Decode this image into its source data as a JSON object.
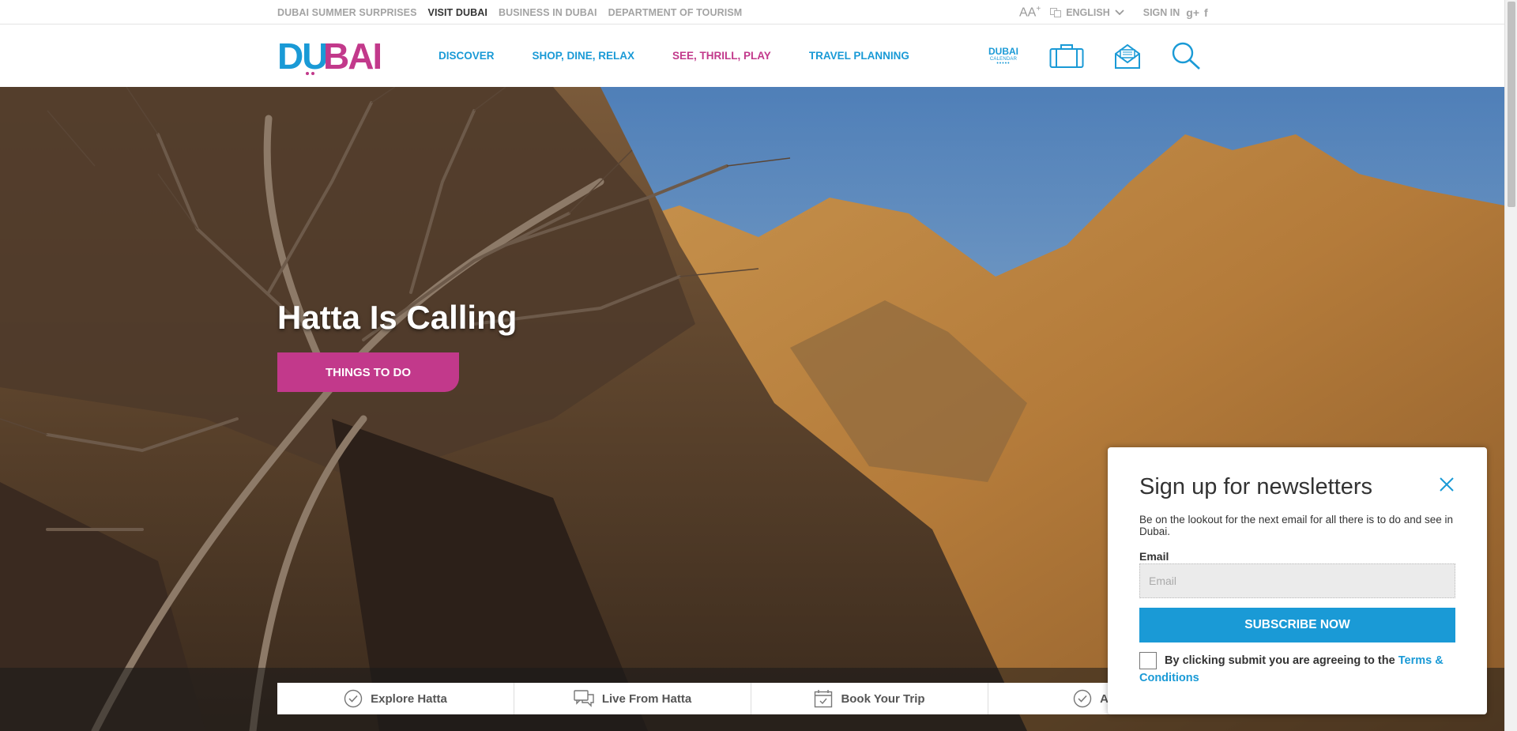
{
  "topbar": {
    "links": [
      "DUBAI SUMMER SURPRISES",
      "VISIT DUBAI",
      "BUSINESS IN DUBAI",
      "DEPARTMENT OF TOURISM"
    ],
    "active_link": "VISIT DUBAI",
    "font_size_label": "AA",
    "font_size_sup": "+",
    "language": "ENGLISH",
    "signin": "SIGN IN",
    "social": [
      "g+",
      "f"
    ]
  },
  "header": {
    "logo_text": "DUBAI",
    "nav": [
      {
        "label": "DISCOVER",
        "color": "#1a9ad6"
      },
      {
        "label": "SHOP, DINE, RELAX",
        "color": "#1a9ad6"
      },
      {
        "label": "SEE, THRILL, PLAY",
        "color": "#c2398b"
      },
      {
        "label": "TRAVEL PLANNING",
        "color": "#1a9ad6"
      }
    ],
    "calendar": {
      "line1": "DUBAI",
      "line2": "CALENDAR",
      "dots": "•••••"
    },
    "icons": [
      "suitcase-icon",
      "newsletter-icon",
      "search-icon"
    ]
  },
  "hero": {
    "title": "Hatta Is Calling",
    "button": "THINGS TO DO"
  },
  "tabs": [
    {
      "label": "Explore Hatta",
      "icon": "check-circle-icon"
    },
    {
      "label": "Live From Hatta",
      "icon": "chat-icon"
    },
    {
      "label": "Book Your Trip",
      "icon": "calendar-icon"
    },
    {
      "label": "Advent",
      "icon": "check-circle-icon"
    }
  ],
  "newsletter": {
    "title": "Sign up for newsletters",
    "description": "Be on the lookout for the next email for all there is to do and see in Dubai.",
    "email_label": "Email",
    "email_placeholder": "Email",
    "email_value": "",
    "subscribe": "SUBSCRIBE NOW",
    "terms_text": "By clicking submit you are agreeing to the",
    "terms_link": "Terms & Conditions"
  },
  "colors": {
    "brand_blue": "#1a9ad6",
    "brand_magenta": "#c2398b"
  }
}
